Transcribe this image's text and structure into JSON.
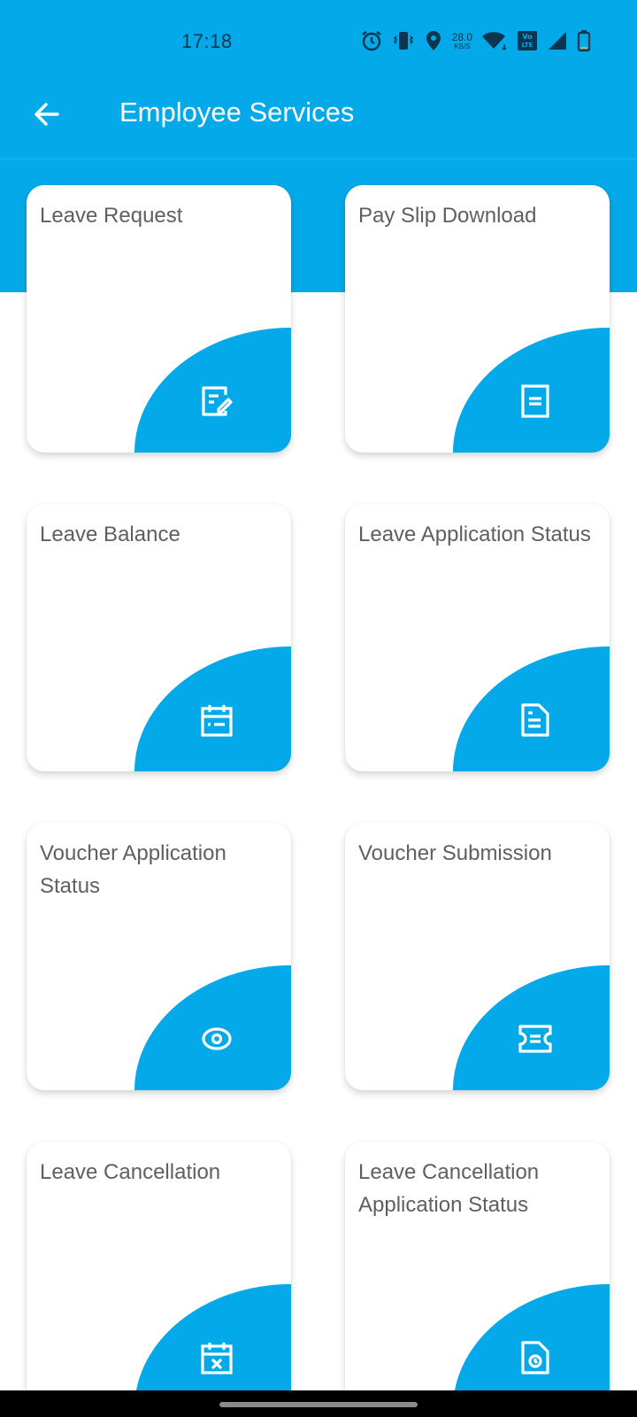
{
  "status_bar": {
    "time": "17:18",
    "network_speed_value": "28.0",
    "network_speed_unit": "KB/S",
    "icons": [
      "alarm-icon",
      "vibrate-icon",
      "location-icon",
      "network-speed",
      "wifi-icon",
      "volte-icon",
      "signal-icon",
      "battery-icon"
    ]
  },
  "app_bar": {
    "back_icon": "arrow-left-icon",
    "title": "Employee Services"
  },
  "colors": {
    "primary": "#03A9E8",
    "card_text": "#5f5f5f",
    "card_background": "#ffffff"
  },
  "services": [
    {
      "label": "Leave Request",
      "icon": "edit-note-icon"
    },
    {
      "label": "Pay Slip Download",
      "icon": "document-icon"
    },
    {
      "label": "Leave Balance",
      "icon": "calendar-icon"
    },
    {
      "label": "Leave Application Status",
      "icon": "file-text-icon"
    },
    {
      "label": "Voucher Application Status",
      "icon": "eye-icon"
    },
    {
      "label": "Voucher Submission",
      "icon": "ticket-icon"
    },
    {
      "label": "Leave Cancellation",
      "icon": "calendar-cancel-icon"
    },
    {
      "label": "Leave Cancellation Application Status",
      "icon": "file-history-icon"
    }
  ]
}
